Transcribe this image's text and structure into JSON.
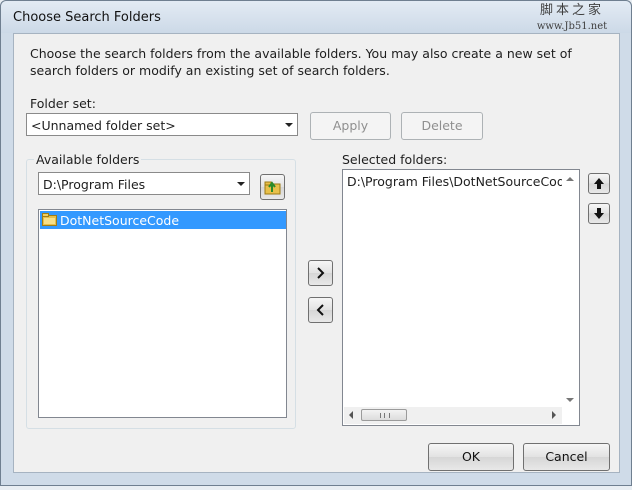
{
  "window": {
    "title": "Choose Search Folders",
    "watermark_line1": "脚本之家",
    "watermark_line2": "www.Jb51.net"
  },
  "description": "Choose the search folders from the available folders. You may also create a new set of search folders or modify an existing set of search folders.",
  "folder_set": {
    "label": "Folder set:",
    "value": "<Unnamed folder set>",
    "apply_label": "Apply",
    "delete_label": "Delete"
  },
  "available": {
    "label": "Available folders",
    "path_value": "D:\\Program Files",
    "items": [
      {
        "label": "DotNetSourceCode",
        "selected": true,
        "icon": "folder-icon"
      }
    ]
  },
  "selected": {
    "label": "Selected folders:",
    "items": [
      {
        "label": "D:\\Program Files\\DotNetSourceCode"
      }
    ]
  },
  "icons": {
    "up_folder": "folder-up-icon",
    "move_right": "chevron-right-icon",
    "move_left": "chevron-left-icon",
    "move_up": "arrow-up-icon",
    "move_down": "arrow-down-icon"
  },
  "buttons": {
    "ok": "OK",
    "cancel": "Cancel"
  },
  "colors": {
    "selection": "#3399ff",
    "folder": "#e8c04a"
  }
}
